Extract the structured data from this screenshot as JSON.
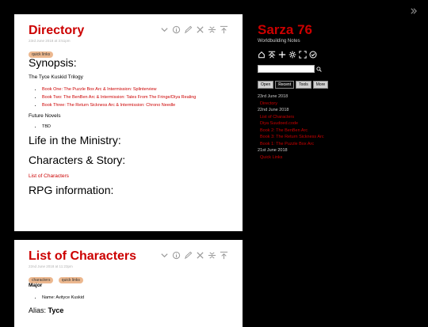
{
  "tiddlers": [
    {
      "title": "Directory",
      "subtitle": "23rd June 2018 at 3:51pm",
      "tags": [
        "quick links"
      ],
      "body": {
        "h_synopsis": "Synopsis:",
        "trilogy": "The Tyce Kuskid Trilogy",
        "books": [
          "Book One: The Puzzle Box Arc & Intermission: Splinterview",
          "Book Two: The BenBen Arc & Intermission: Tales From The Fringe/Diya Realing",
          "Book Three: The Return Sickness Arc & Intermission: Chrono Needle"
        ],
        "future": "Future Novels",
        "future_items": [
          "TBD"
        ],
        "h_ministry": "Life in the Ministry:",
        "h_characters": "Characters & Story:",
        "characters_link": "List of Characters",
        "h_rpg": "RPG information:"
      }
    },
    {
      "title": "List of Characters",
      "subtitle": "22nd June 2018 at 11:23pm",
      "tags": [
        "characters",
        "quick links"
      ],
      "body": {
        "major": "Major",
        "name_item": "Name: Avityce Kuskid",
        "alias_label": "Alias:",
        "alias_value": "Tyce"
      }
    }
  ],
  "tool_icons": [
    "chevron-down-icon",
    "info-icon",
    "edit-icon",
    "close-icon",
    "fold-icon",
    "unfold-icon"
  ],
  "sidebar": {
    "title": "Sarza 76",
    "subtitle": "Worldbuilding Notes",
    "page_icons": [
      "home-icon",
      "close-all-icon",
      "new-tiddler-icon",
      "control-panel-icon",
      "fullscreen-icon",
      "save-icon"
    ],
    "search_placeholder": "",
    "tabs": [
      "Open",
      "Recent",
      "Tools",
      "More"
    ],
    "active_tab": "Recent",
    "recent": [
      {
        "date": "23rd June 2018",
        "items": [
          "Directory"
        ]
      },
      {
        "date": "22nd June 2018",
        "items": [
          "List of Characters",
          "Diya Suudoed.code",
          "Book 2: The BenBen Arc",
          "Book 3: The Return Sickness Arc",
          "Book 1: The Puzzle Box Arc"
        ]
      },
      {
        "date": "21st June 2018",
        "items": [
          "Quick Links"
        ]
      }
    ]
  },
  "colors": {
    "accent": "#cc0000",
    "tag": "#ecb88f",
    "background": "#000000",
    "card": "#ffffff"
  }
}
